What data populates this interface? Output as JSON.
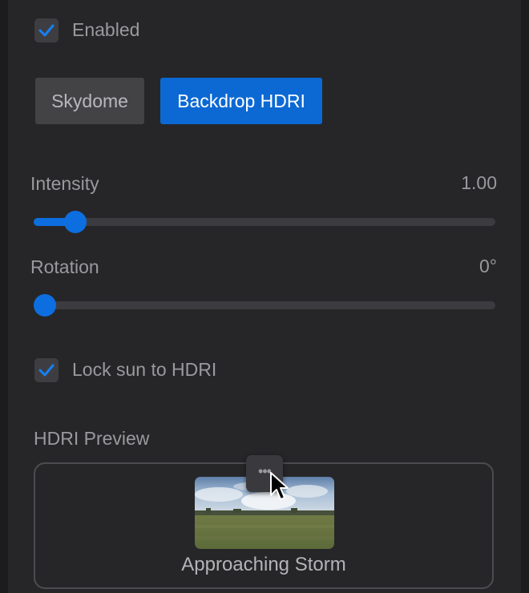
{
  "enabled": {
    "label": "Enabled",
    "checked": true
  },
  "mode": {
    "options": [
      "Skydome",
      "Backdrop HDRI"
    ],
    "selected": "Backdrop HDRI"
  },
  "intensity": {
    "label": "Intensity",
    "value_text": "1.00",
    "slider_fraction": 0.07
  },
  "rotation": {
    "label": "Rotation",
    "value_text": "0°",
    "slider_fraction": 0.0
  },
  "lock_sun": {
    "label": "Lock sun to HDRI",
    "checked": true
  },
  "preview": {
    "heading": "HDRI Preview",
    "caption": "Approaching Storm",
    "more_button_icon": "more-horizontal-icon"
  },
  "colors": {
    "accent": "#0c69d3",
    "panel": "#262628",
    "text": "#9a9a9e"
  }
}
